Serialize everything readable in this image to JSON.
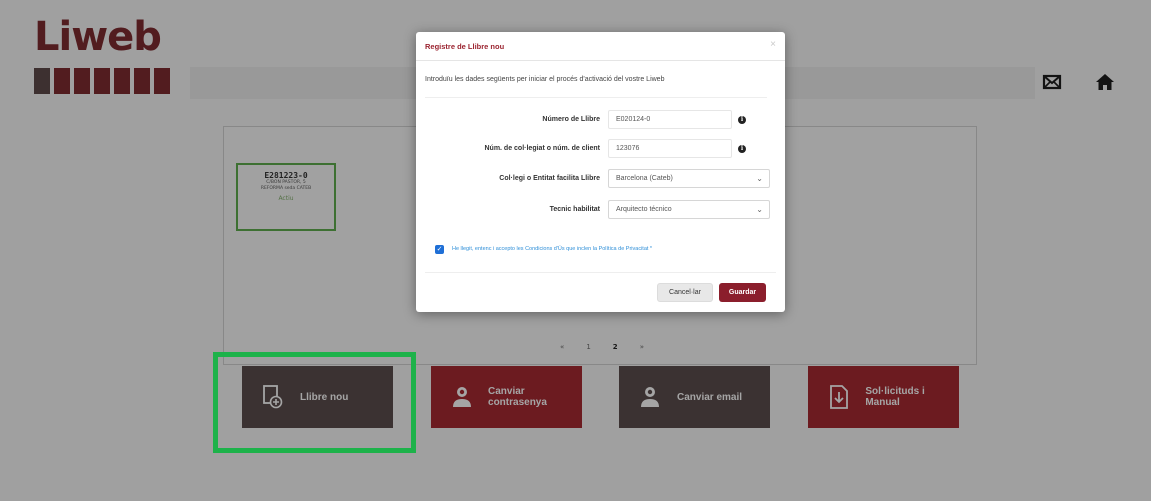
{
  "app": {
    "logo_text": "Liweb",
    "logo_bar_colors": [
      "#5a4848",
      "#7a2a2e",
      "#7a2a2e",
      "#7a2a2e",
      "#7a2a2e",
      "#7a2a2e",
      "#7a2a2e"
    ],
    "header_icons": [
      "envelope-icon",
      "home-icon"
    ]
  },
  "card": {
    "number": "E281223-0",
    "line1": "C/BON PASTOR, 5",
    "line2": "REFORMA seda CATEB",
    "status": "Actiu"
  },
  "pager": {
    "prev": "«",
    "page1": "1",
    "page2": "2",
    "next": "»",
    "active_page": 2
  },
  "actions": [
    {
      "label": "Llibre nou",
      "icon": "new-book-icon",
      "color": "#584a4a"
    },
    {
      "label": "Canviar contrasenya",
      "icon": "user-icon",
      "color": "#a02830"
    },
    {
      "label": "Canviar email",
      "icon": "user-icon",
      "color": "#584a4a"
    },
    {
      "label": "Sol·licituds i Manual",
      "icon": "document-download-icon",
      "color": "#a02830"
    }
  ],
  "highlight_color": "#1db24a",
  "modal": {
    "title": "Registre de Llibre nou",
    "close": "×",
    "intro": "Introduïu les dades següents per iniciar el procés d'activació del vostre Liweb",
    "fields": {
      "numero_llibre": {
        "label": "Número de Llibre",
        "value": "E020124-0"
      },
      "num_collegiat": {
        "label": "Núm. de col·legiat o núm. de client",
        "value": "123076"
      },
      "collegi": {
        "label": "Col·legi o Entitat facilita Llibre",
        "value": "Barcelona (Cateb)"
      },
      "tecnic": {
        "label": "Tecnic habilitat",
        "value": "Arquitecto técnico"
      }
    },
    "terms": "He llegit, entenc i accepto les Condicions d'Ús que inclen la Política de Privacitat *",
    "terms_checked": true,
    "cancel_label": "Cancel·lar",
    "save_label": "Guardar"
  }
}
